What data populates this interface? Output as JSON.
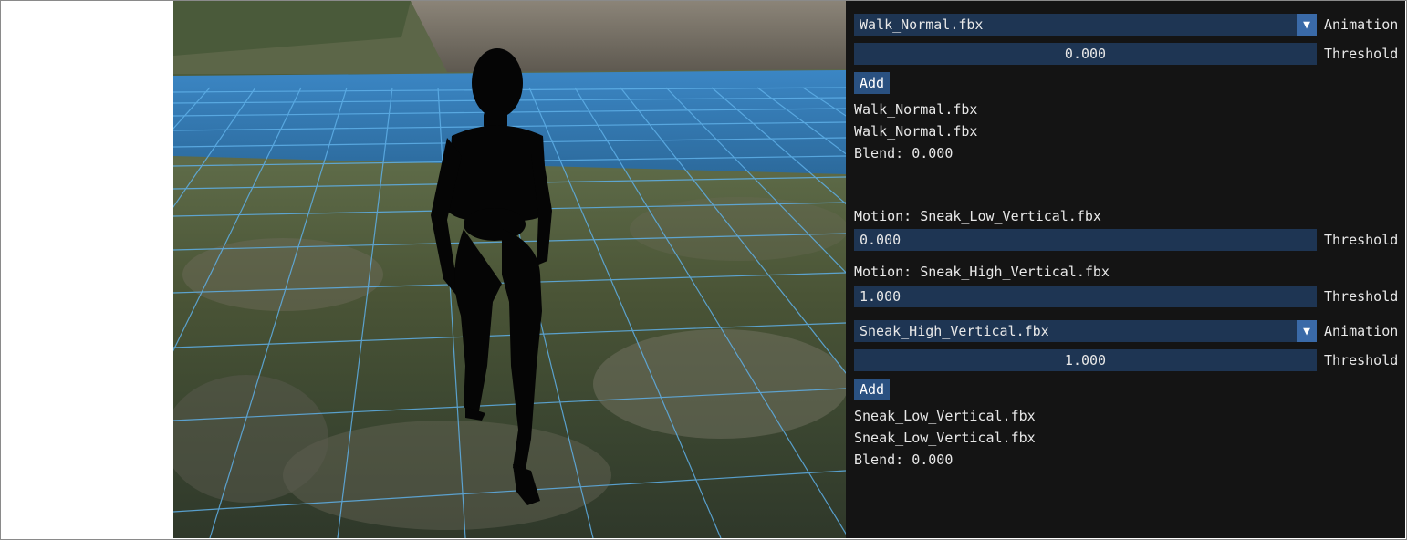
{
  "viewport": {
    "name": "3d-viewport",
    "colors": {
      "grid": "#5fb0e8",
      "water": "#3b86c4",
      "figure": "#050505"
    }
  },
  "panel": {
    "group1": {
      "animation_select": {
        "value": "Walk_Normal.fbx",
        "label": "Animation"
      },
      "threshold": {
        "value": "0.000",
        "label": "Threshold"
      },
      "add_label": "Add",
      "lines": [
        "Walk_Normal.fbx",
        "Walk_Normal.fbx",
        "Blend: 0.000"
      ]
    },
    "motions": [
      {
        "title": "Motion: Sneak_Low_Vertical.fbx",
        "threshold": "0.000",
        "label": "Threshold"
      },
      {
        "title": "Motion: Sneak_High_Vertical.fbx",
        "threshold": "1.000",
        "label": "Threshold"
      }
    ],
    "group2": {
      "animation_select": {
        "value": "Sneak_High_Vertical.fbx",
        "label": "Animation"
      },
      "threshold": {
        "value": "1.000",
        "label": "Threshold"
      },
      "add_label": "Add",
      "lines": [
        "Sneak_Low_Vertical.fbx",
        "Sneak_Low_Vertical.fbx",
        "Blend: 0.000"
      ]
    },
    "dropdown_arrow": "▼"
  }
}
